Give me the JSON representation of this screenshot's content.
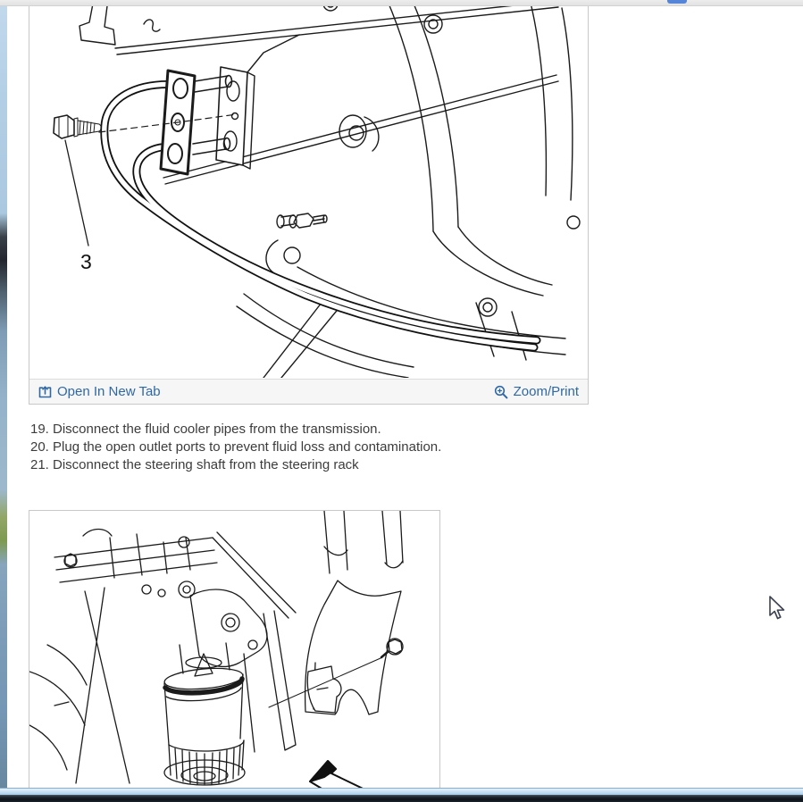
{
  "chrome": {
    "tab_accent_color": "#5585d8",
    "top_bar_color": "#ededed",
    "window_edge_color": "#c6def3",
    "taskbar_color": "#161b22"
  },
  "figure1": {
    "description": "transmission fluid cooler pipes line drawing",
    "callout_label": "3",
    "footer": {
      "open_in_new_tab_label": "Open In New Tab",
      "zoom_print_label": "Zoom/Print",
      "link_color": "#2e68a6",
      "icons": {
        "open_in_new_tab": "box-arrow-up-icon",
        "zoom_print": "magnifier-plus-icon"
      }
    }
  },
  "steps": [
    "19. Disconnect the fluid cooler pipes from the transmission.",
    "20. Plug the open outlet ports to prevent fluid loss and contamination.",
    "21. Disconnect the steering shaft from the steering rack"
  ],
  "figure2": {
    "description": "engine oil filter and bracket line drawing"
  },
  "text_color": "#3c3c3c"
}
